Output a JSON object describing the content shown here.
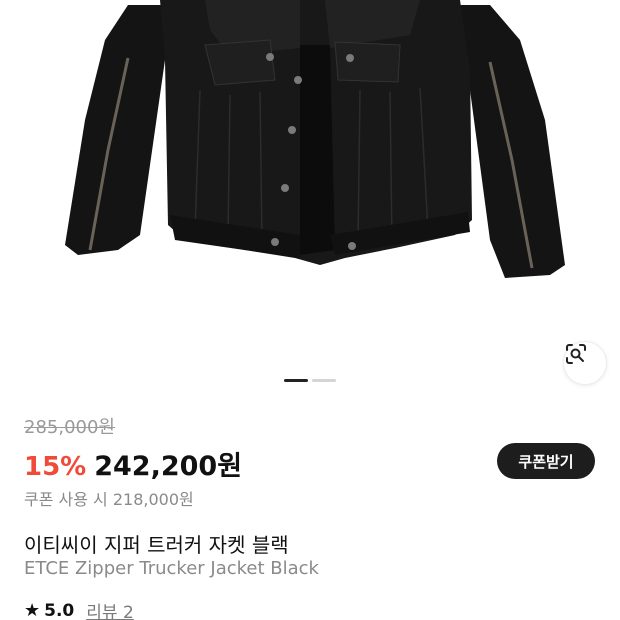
{
  "product": {
    "image_alt": "ETCE Zipper Trucker Jacket Black",
    "pager": {
      "current": 1,
      "total": 2
    },
    "original_price": "285,000원",
    "discount": "15%",
    "sale_price": "242,200원",
    "coupon_button": "쿠폰받기",
    "coupon_price": "쿠폰 사용 시 218,000원",
    "title_ko": "이티씨이 지퍼 트러커 자켓 블랙",
    "title_en": "ETCE Zipper Trucker Jacket Black",
    "rating": "5.0",
    "review_link": "리뷰 2"
  },
  "colors": {
    "discount": "#f04b38",
    "coupon_button_bg": "#1d1d1d",
    "muted_text": "#8a8a8a"
  },
  "icons": {
    "lens": "lens-search-icon",
    "star": "star-icon"
  }
}
